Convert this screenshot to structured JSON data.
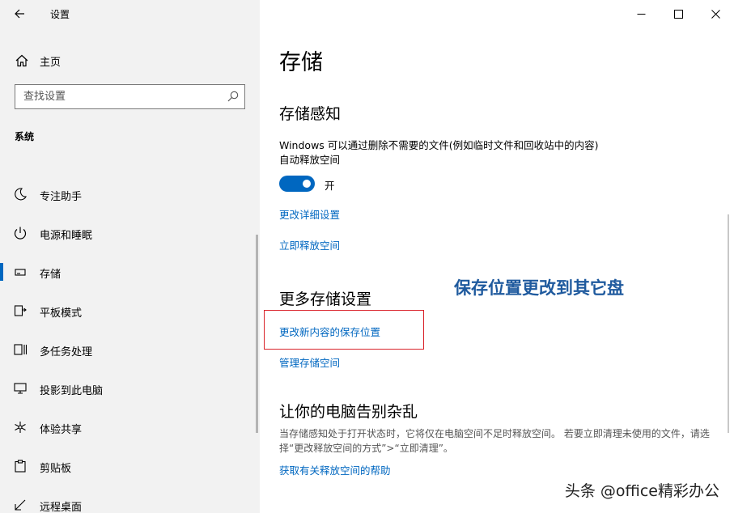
{
  "window": {
    "title": "设置"
  },
  "sidebar": {
    "home_label": "主页",
    "search_placeholder": "查找设置",
    "section_label": "系统",
    "items": [
      {
        "label": "专注助手",
        "icon": "moon-icon"
      },
      {
        "label": "电源和睡眠",
        "icon": "power-icon"
      },
      {
        "label": "存储",
        "icon": "storage-icon",
        "selected": true
      },
      {
        "label": "平板模式",
        "icon": "tablet-mode-icon"
      },
      {
        "label": "多任务处理",
        "icon": "multitasking-icon"
      },
      {
        "label": "投影到此电脑",
        "icon": "projecting-icon"
      },
      {
        "label": "体验共享",
        "icon": "shared-experiences-icon"
      },
      {
        "label": "剪贴板",
        "icon": "clipboard-icon"
      },
      {
        "label": "远程桌面",
        "icon": "remote-desktop-icon"
      }
    ]
  },
  "main": {
    "page_title": "存储",
    "storage_sense": {
      "heading": "存储感知",
      "description_line1": "Windows 可以通过删除不需要的文件(例如临时文件和回收站中的内容)",
      "description_line2": "自动释放空间",
      "toggle_state": "开",
      "link_change_settings": "更改详细设置",
      "link_free_now": "立即释放空间"
    },
    "more_settings": {
      "heading": "更多存储设置",
      "link_change_save_location": "更改新内容的保存位置",
      "link_manage_spaces": "管理存储空间"
    },
    "declutter": {
      "heading": "让你的电脑告别杂乱",
      "description": "当存储感知处于打开状态时，它将仅在电脑空间不足时释放空间。 若要立即清理未使用的文件，请选择“更改释放空间的方式”>“立即清理”。",
      "link_help": "获取有关释放空间的帮助"
    }
  },
  "annotation": {
    "text": "保存位置更改到其它盘",
    "color": "#1f5a9e"
  },
  "watermark": {
    "text": "头条 @office精彩办公"
  },
  "colors": {
    "accent": "#0067c0",
    "highlight_border": "#d9232a",
    "sidebar_bg": "#f2f2f2"
  }
}
